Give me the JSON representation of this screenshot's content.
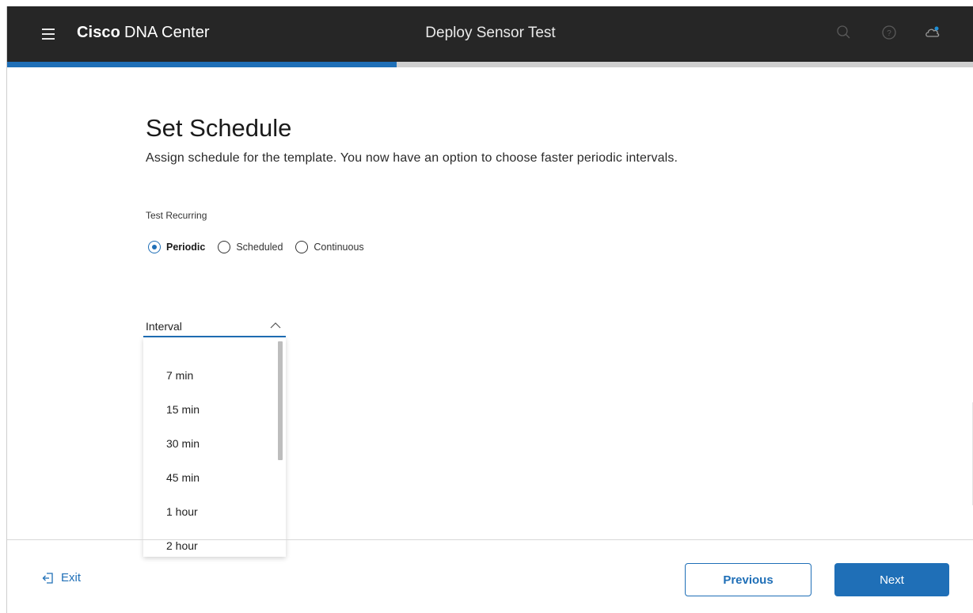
{
  "app": {
    "brand_bold": "Cisco",
    "brand_rest": "DNA Center",
    "page_heading": "Deploy Sensor Test"
  },
  "topbar_icons": [
    "search-icon",
    "help-icon",
    "cloud-notification-icon"
  ],
  "progress": {
    "fraction": 0.403
  },
  "main": {
    "title": "Set Schedule",
    "subtitle": "Assign schedule for the template. You now have an option to choose faster periodic intervals.",
    "recurring_label": "Test Recurring",
    "recurring_options": [
      {
        "label": "Periodic",
        "selected": true
      },
      {
        "label": "Scheduled",
        "selected": false
      },
      {
        "label": "Continuous",
        "selected": false
      }
    ],
    "interval": {
      "label": "Interval",
      "options": [
        "7 min",
        "15 min",
        "30 min",
        "45 min",
        "1 hour",
        "2 hour"
      ]
    }
  },
  "footer": {
    "exit_label": "Exit",
    "previous_label": "Previous",
    "next_label": "Next"
  },
  "colors": {
    "accent": "#1f6fb7",
    "topbar_bg": "#262626"
  }
}
